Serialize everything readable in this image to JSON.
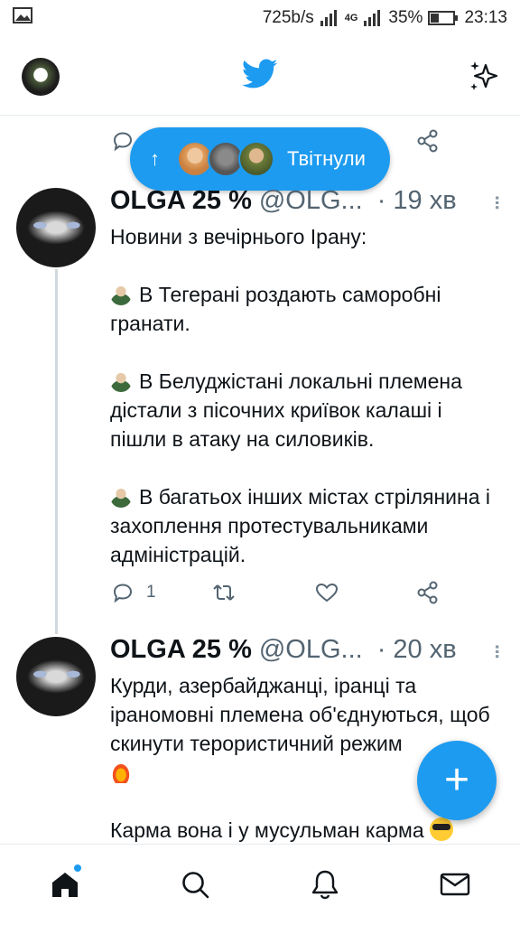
{
  "status_bar": {
    "speed": "725b/s",
    "network": "4G",
    "battery": "35%",
    "time": "23:13"
  },
  "app": {
    "brand_color": "#1d9bf0"
  },
  "pill": {
    "label": "Твітнули",
    "arrow": "↑"
  },
  "tweets": [
    {
      "name": "OLGA 25 %",
      "handle": "@OLG...",
      "separator": "·",
      "time": "19 хв",
      "lines": {
        "intro": "Новини з вечірнього Ірану:",
        "p1": "В Тегерані роздають саморобні гранати.",
        "p2": "В Белуджістані локальні племена дістали з пісочних криївок калаші і пішли в атаку на силовиків.",
        "p3": "В багатьох інших містах стрілянина і захоплення протестувальниками адміністрацій."
      },
      "reply_count": "1"
    },
    {
      "name": "OLGA 25 %",
      "handle": "@OLG...",
      "separator": "·",
      "time": "20 хв",
      "lines": {
        "p1": "Курди, азербайджанці, іранці та іраномовні племена об'єднуються, щоб скинути терористичний режим",
        "p2": "Карма вона і у мусульман карма"
      }
    }
  ],
  "fab": {
    "label": "+"
  },
  "icons": [
    "image-icon",
    "signal-icon",
    "battery-icon",
    "twitter-bird-icon",
    "sparkle-icon",
    "reply-icon",
    "retweet-icon",
    "like-icon",
    "share-icon",
    "home-icon",
    "search-icon",
    "bell-icon",
    "mail-icon"
  ]
}
